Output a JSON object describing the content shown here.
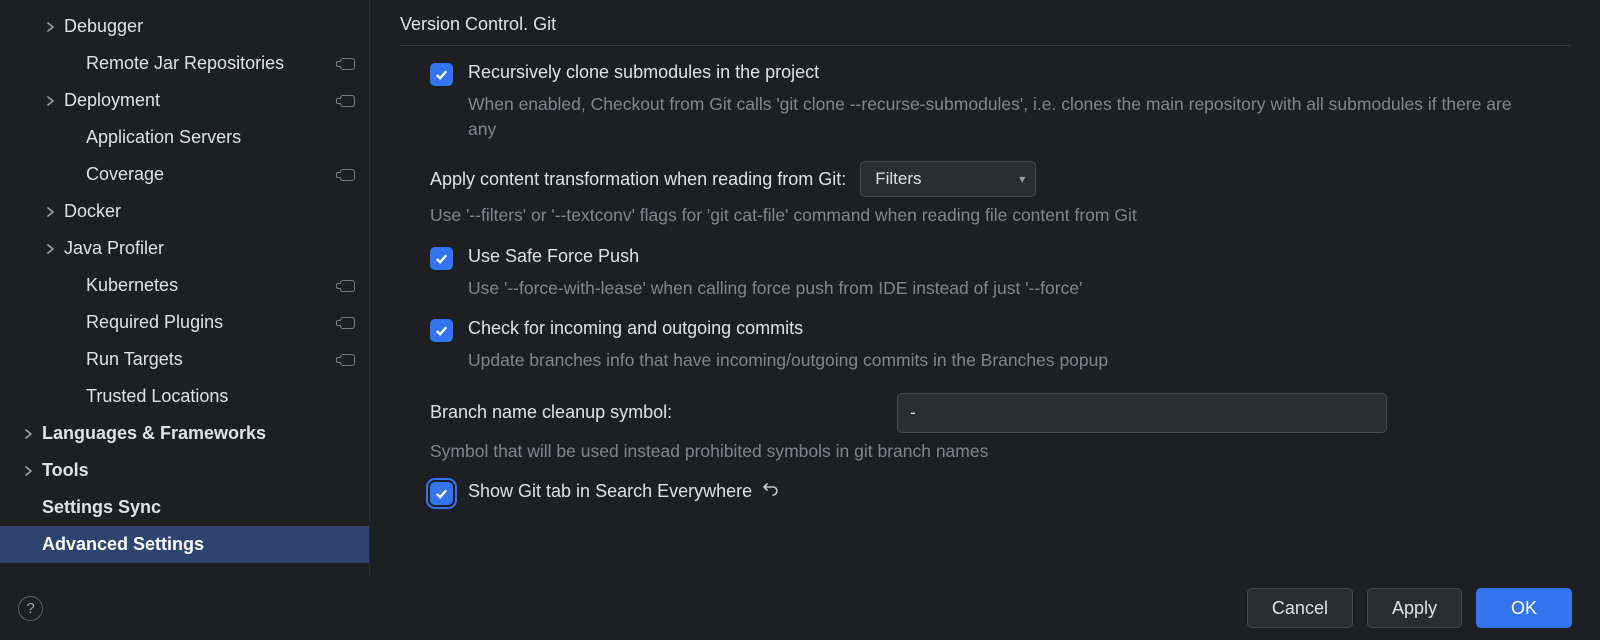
{
  "sidebar": {
    "items": [
      {
        "label": "Debugger",
        "level": 1,
        "chevron": true,
        "tag": false
      },
      {
        "label": "Remote Jar Repositories",
        "level": 2,
        "chevron": false,
        "tag": true
      },
      {
        "label": "Deployment",
        "level": 1,
        "chevron": true,
        "tag": true
      },
      {
        "label": "Application Servers",
        "level": 2,
        "chevron": false,
        "tag": false
      },
      {
        "label": "Coverage",
        "level": 2,
        "chevron": false,
        "tag": true
      },
      {
        "label": "Docker",
        "level": 1,
        "chevron": true,
        "tag": false
      },
      {
        "label": "Java Profiler",
        "level": 1,
        "chevron": true,
        "tag": false
      },
      {
        "label": "Kubernetes",
        "level": 2,
        "chevron": false,
        "tag": true
      },
      {
        "label": "Required Plugins",
        "level": 2,
        "chevron": false,
        "tag": true
      },
      {
        "label": "Run Targets",
        "level": 2,
        "chevron": false,
        "tag": true
      },
      {
        "label": "Trusted Locations",
        "level": 2,
        "chevron": false,
        "tag": false
      },
      {
        "label": "Languages & Frameworks",
        "level": 0,
        "chevron": true,
        "tag": false,
        "bold": true
      },
      {
        "label": "Tools",
        "level": 0,
        "chevron": true,
        "tag": false,
        "bold": true
      },
      {
        "label": "Settings Sync",
        "level": 0,
        "chevron": false,
        "tag": false,
        "bold": true
      },
      {
        "label": "Advanced Settings",
        "level": 0,
        "chevron": false,
        "tag": false,
        "bold": true,
        "selected": true
      }
    ]
  },
  "section": {
    "title": "Version Control. Git"
  },
  "settings": {
    "recurse": {
      "label": "Recursively clone submodules in the project",
      "desc": "When enabled, Checkout from Git calls 'git clone --recurse-submodules', i.e. clones the main repository with all submodules if there are any",
      "checked": true
    },
    "transform": {
      "label": "Apply content transformation when reading from Git:",
      "value": "Filters",
      "desc": "Use '--filters' or '--textconv' flags for 'git cat-file' command when reading file content from Git"
    },
    "safepush": {
      "label": "Use Safe Force Push",
      "desc": "Use '--force-with-lease' when calling force push from IDE instead of just '--force'",
      "checked": true
    },
    "incoming": {
      "label": "Check for incoming and outgoing commits",
      "desc": "Update branches info that have incoming/outgoing commits in the Branches popup",
      "checked": true
    },
    "cleanup": {
      "label": "Branch name cleanup symbol:",
      "value": "-",
      "desc": "Symbol that will be used instead prohibited symbols in git branch names"
    },
    "searchtab": {
      "label": "Show Git tab in Search Everywhere",
      "checked": true,
      "revert": true
    }
  },
  "footer": {
    "cancel": "Cancel",
    "apply": "Apply",
    "ok": "OK"
  }
}
